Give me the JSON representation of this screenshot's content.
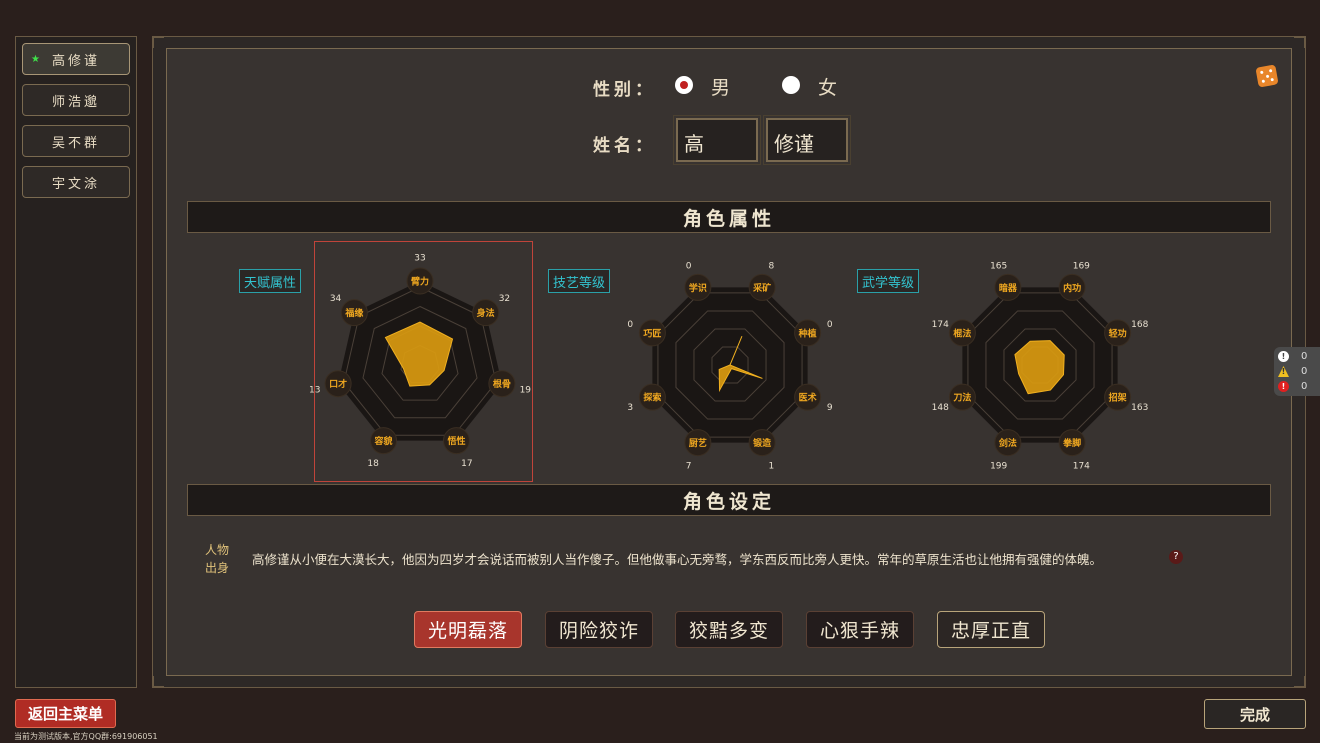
{
  "sidebar": {
    "characters": [
      {
        "name": "高修谨",
        "active": true
      },
      {
        "name": "师浩邈",
        "active": false
      },
      {
        "name": "吴不群",
        "active": false
      },
      {
        "name": "宇文涂",
        "active": false
      }
    ]
  },
  "form": {
    "gender_label": "性别：",
    "gender_options": [
      "男",
      "女"
    ],
    "gender_selected": "男",
    "name_label": "姓名：",
    "surname": "高",
    "given_name": "修谨"
  },
  "sections": {
    "attributes_title": "角色属性",
    "settings_title": "角色设定"
  },
  "radars": [
    {
      "tag": "天赋属性",
      "labels": [
        "臂力",
        "身法",
        "根骨",
        "悟性",
        "容貌",
        "口才",
        "福缘"
      ],
      "values": [
        33,
        32,
        19,
        17,
        18,
        13,
        34
      ],
      "max": 60,
      "color": "#d99a10"
    },
    {
      "tag": "技艺等级",
      "labels": [
        "学识",
        "采矿",
        "种植",
        "医术",
        "锻造",
        "厨艺",
        "探索",
        "巧匠"
      ],
      "values": [
        0,
        8,
        0,
        9,
        1,
        7,
        3,
        0
      ],
      "max": 20,
      "color": "#d99a10"
    },
    {
      "tag": "武学等级",
      "labels": [
        "暗器",
        "内功",
        "轻功",
        "招架",
        "拳脚",
        "剑法",
        "刀法",
        "棍法"
      ],
      "values": [
        165,
        169,
        168,
        163,
        174,
        199,
        148,
        174
      ],
      "max": 500,
      "color": "#d99a10"
    }
  ],
  "bio": {
    "label": "人物出身",
    "text": "高修谨从小便在大漠长大，他因为四岁才会说话而被别人当作傻子。但他做事心无旁骛，学东西反而比旁人更快。常年的草原生活也让他拥有强健的体魄。",
    "help": "?"
  },
  "traits": [
    {
      "label": "光明磊落",
      "state": "active"
    },
    {
      "label": "阴险狡诈",
      "state": "normal"
    },
    {
      "label": "狡黠多变",
      "state": "normal"
    },
    {
      "label": "心狠手辣",
      "state": "normal"
    },
    {
      "label": "忠厚正直",
      "state": "outline"
    }
  ],
  "buttons": {
    "back": "返回主菜单",
    "done": "完成"
  },
  "footer": {
    "version": "当前为测试版本,官方QQ群:691906051"
  },
  "status": {
    "info": "0",
    "warning": "0",
    "error": "0"
  },
  "icons": {
    "star": "star-icon",
    "dice": "dice-icon"
  }
}
